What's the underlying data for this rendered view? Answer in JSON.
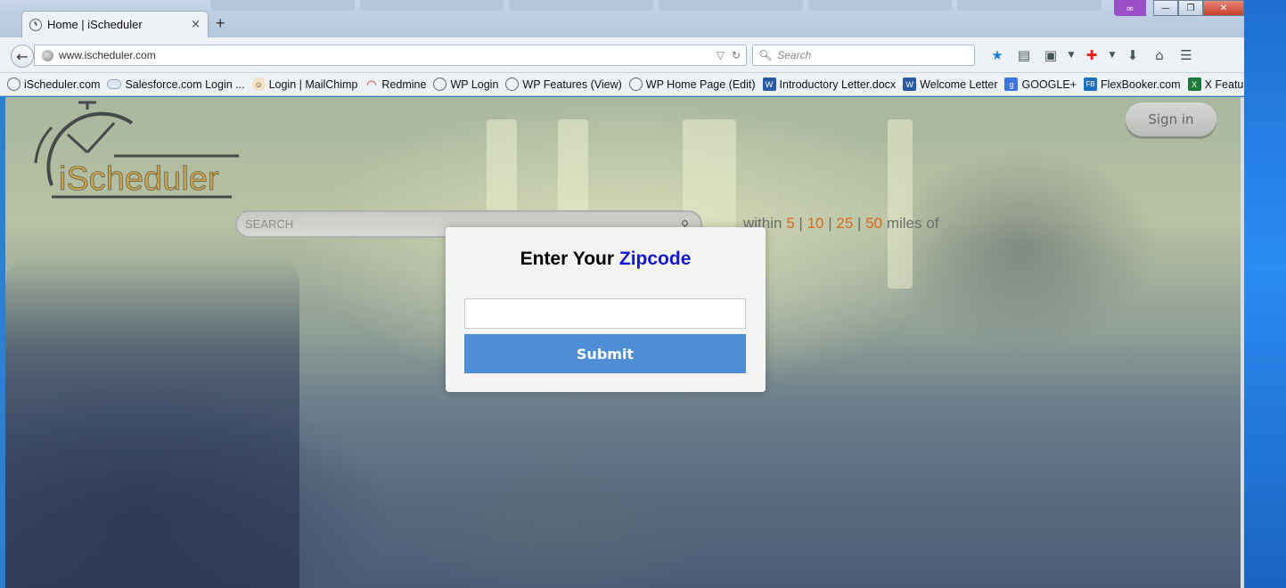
{
  "browser": {
    "tab": {
      "title": "Home | iScheduler",
      "close": "×"
    },
    "new_tab": "+",
    "window_buttons": {
      "minimize": "—",
      "maximize": "❐",
      "close": "✕"
    },
    "url": "www.ischeduler.com",
    "search_placeholder": "Search",
    "bookmarks": [
      {
        "label": "iScheduler.com",
        "icon": "clock-icon"
      },
      {
        "label": "Salesforce.com Login ...",
        "icon": "cloud-icon"
      },
      {
        "label": "Login | MailChimp",
        "icon": "mailchimp-icon"
      },
      {
        "label": "Redmine",
        "icon": "redmine-icon"
      },
      {
        "label": "WP Login",
        "icon": "clock-icon"
      },
      {
        "label": "WP Features (View)",
        "icon": "clock-icon"
      },
      {
        "label": "WP Home Page (Edit)",
        "icon": "clock-icon"
      },
      {
        "label": "Introductory Letter.docx",
        "icon": "word-icon",
        "glyph": "W"
      },
      {
        "label": "Welcome Letter",
        "icon": "word-icon",
        "glyph": "W"
      },
      {
        "label": "GOOGLE+",
        "icon": "google-icon",
        "glyph": "g"
      },
      {
        "label": "FlexBooker.com",
        "icon": "flexbooker-icon",
        "glyph": "FB"
      },
      {
        "label": "X FeatureList",
        "icon": "excel-icon",
        "glyph": "X"
      }
    ],
    "more_bookmarks": "»"
  },
  "page": {
    "logo_text": "iScheduler",
    "signin_label": "Sign in",
    "search_placeholder": "SEARCH",
    "within": {
      "prefix": "within",
      "options": [
        "5",
        "10",
        "25",
        "50"
      ],
      "separator": "|",
      "suffix": "miles of"
    }
  },
  "modal": {
    "title_prefix": "Enter Your",
    "title_highlight": "Zipcode",
    "zip_value": "",
    "submit_label": "Submit"
  },
  "colors": {
    "accent_orange": "#d4691e",
    "submit_blue": "#4e8ed7",
    "zipcode_blue": "#1515d8",
    "logo_gold": "#c9a44a"
  }
}
